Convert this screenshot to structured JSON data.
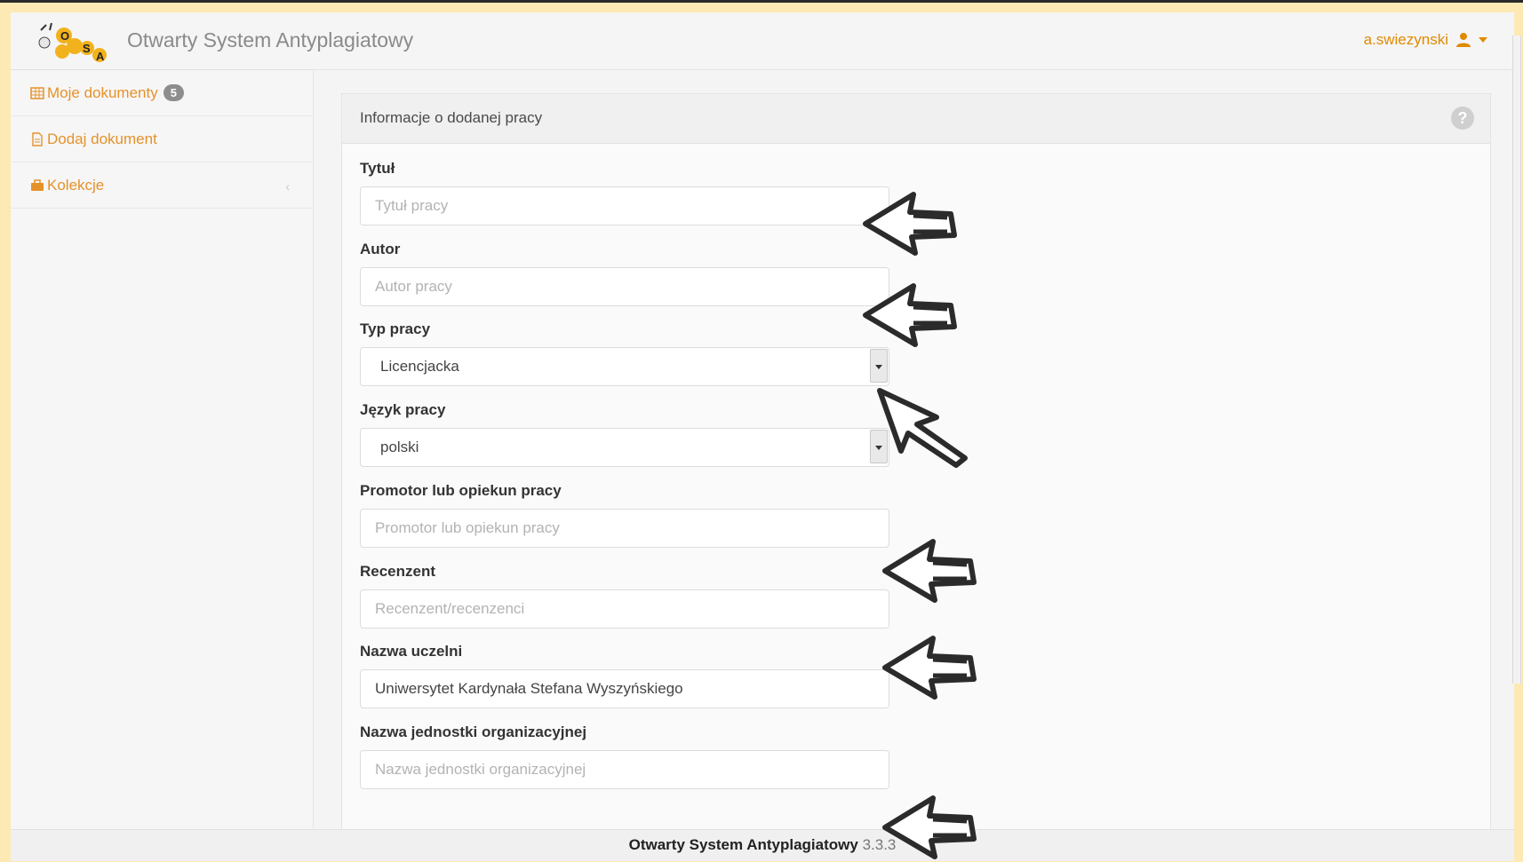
{
  "app": {
    "title": "Otwarty System Antyplagiatowy",
    "logo_text": "OSA",
    "user": "a.swiezynski"
  },
  "sidebar": {
    "items": [
      {
        "label": "Moje dokumenty",
        "badge": "5",
        "icon": "table-icon"
      },
      {
        "label": "Dodaj dokument",
        "icon": "file-icon"
      },
      {
        "label": "Kolekcje",
        "icon": "briefcase-icon",
        "chevron": "‹"
      }
    ]
  },
  "panel": {
    "title": "Informacje o dodanej pracy",
    "help_icon": "?"
  },
  "form": {
    "title": {
      "label": "Tytuł",
      "placeholder": "Tytuł pracy",
      "value": ""
    },
    "author": {
      "label": "Autor",
      "placeholder": "Autor pracy",
      "value": ""
    },
    "type": {
      "label": "Typ pracy",
      "value": "Licencjacka"
    },
    "language": {
      "label": "Język pracy",
      "value": "polski"
    },
    "promoter": {
      "label": "Promotor lub opiekun pracy",
      "placeholder": "Promotor lub opiekun pracy",
      "value": ""
    },
    "reviewer": {
      "label": "Recenzent",
      "placeholder": "Recenzent/recenzenci",
      "value": ""
    },
    "university": {
      "label": "Nazwa uczelni",
      "placeholder": "",
      "value": "Uniwersytet Kardynała Stefana Wyszyńskiego"
    },
    "unit": {
      "label": "Nazwa jednostki organizacyjnej",
      "placeholder": "Nazwa jednostki organizacyjnej",
      "value": ""
    }
  },
  "footer": {
    "name": "Otwarty System Antyplagiatowy",
    "version": "3.3.3"
  },
  "colors": {
    "accent": "#e5922a",
    "page_background": "#fde9b4",
    "annotation_arrow": "#2b2b2b"
  }
}
